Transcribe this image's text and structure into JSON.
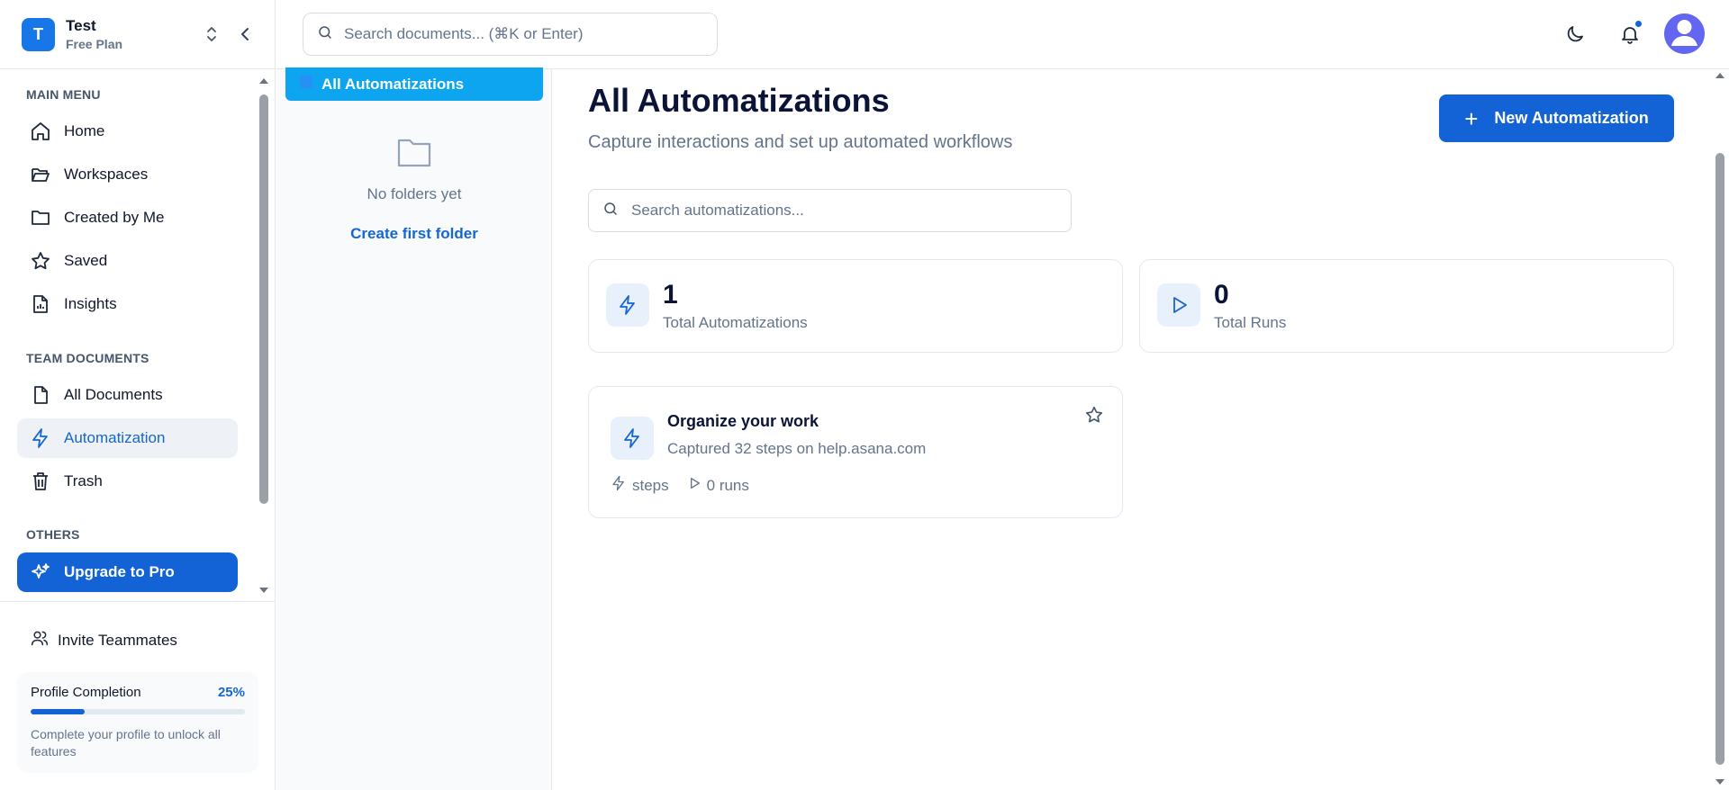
{
  "workspace": {
    "initial": "T",
    "name": "Test",
    "plan": "Free Plan"
  },
  "sidebar": {
    "main_menu_label": "MAIN MENU",
    "main_menu": [
      {
        "label": "Home",
        "icon": "home-icon"
      },
      {
        "label": "Workspaces",
        "icon": "folder-open-icon"
      },
      {
        "label": "Created by Me",
        "icon": "folder-icon"
      },
      {
        "label": "Saved",
        "icon": "star-icon"
      },
      {
        "label": "Insights",
        "icon": "document-chart-icon"
      }
    ],
    "team_label": "TEAM DOCUMENTS",
    "team": [
      {
        "label": "All Documents",
        "icon": "file-icon"
      },
      {
        "label": "Automatization",
        "icon": "lightning-icon",
        "active": true
      },
      {
        "label": "Trash",
        "icon": "trash-icon"
      }
    ],
    "others_label": "OTHERS",
    "others": [
      {
        "label": "Upgrade to Pro",
        "icon": "sparkles-icon"
      }
    ],
    "invite_label": "Invite Teammates",
    "profile": {
      "title": "Profile Completion",
      "percent_label": "25%",
      "percent": 0.25,
      "description": "Complete your profile to unlock all features"
    }
  },
  "topbar": {
    "search_placeholder": "Search documents... (⌘K or Enter)"
  },
  "folders": {
    "all_label": "All Automatizations",
    "empty_text": "No folders yet",
    "create_link": "Create first folder"
  },
  "main": {
    "title": "All Automatizations",
    "subtitle": "Capture interactions and set up automated workflows",
    "new_button": "New Automatization",
    "search_placeholder": "Search automatizations...",
    "stats": [
      {
        "value": "1",
        "label": "Total Automatizations",
        "icon": "lightning-icon"
      },
      {
        "value": "0",
        "label": "Total Runs",
        "icon": "play-icon"
      }
    ],
    "automations": [
      {
        "title": "Organize your work",
        "description": "Captured 32 steps on help.asana.com",
        "steps_label": "steps",
        "runs_label": "0 runs"
      }
    ]
  },
  "colors": {
    "primary": "#1363d6",
    "accent_light": "#e7f0fb",
    "folder_selected": "#0ea5f0",
    "avatar": "#6366f1"
  }
}
